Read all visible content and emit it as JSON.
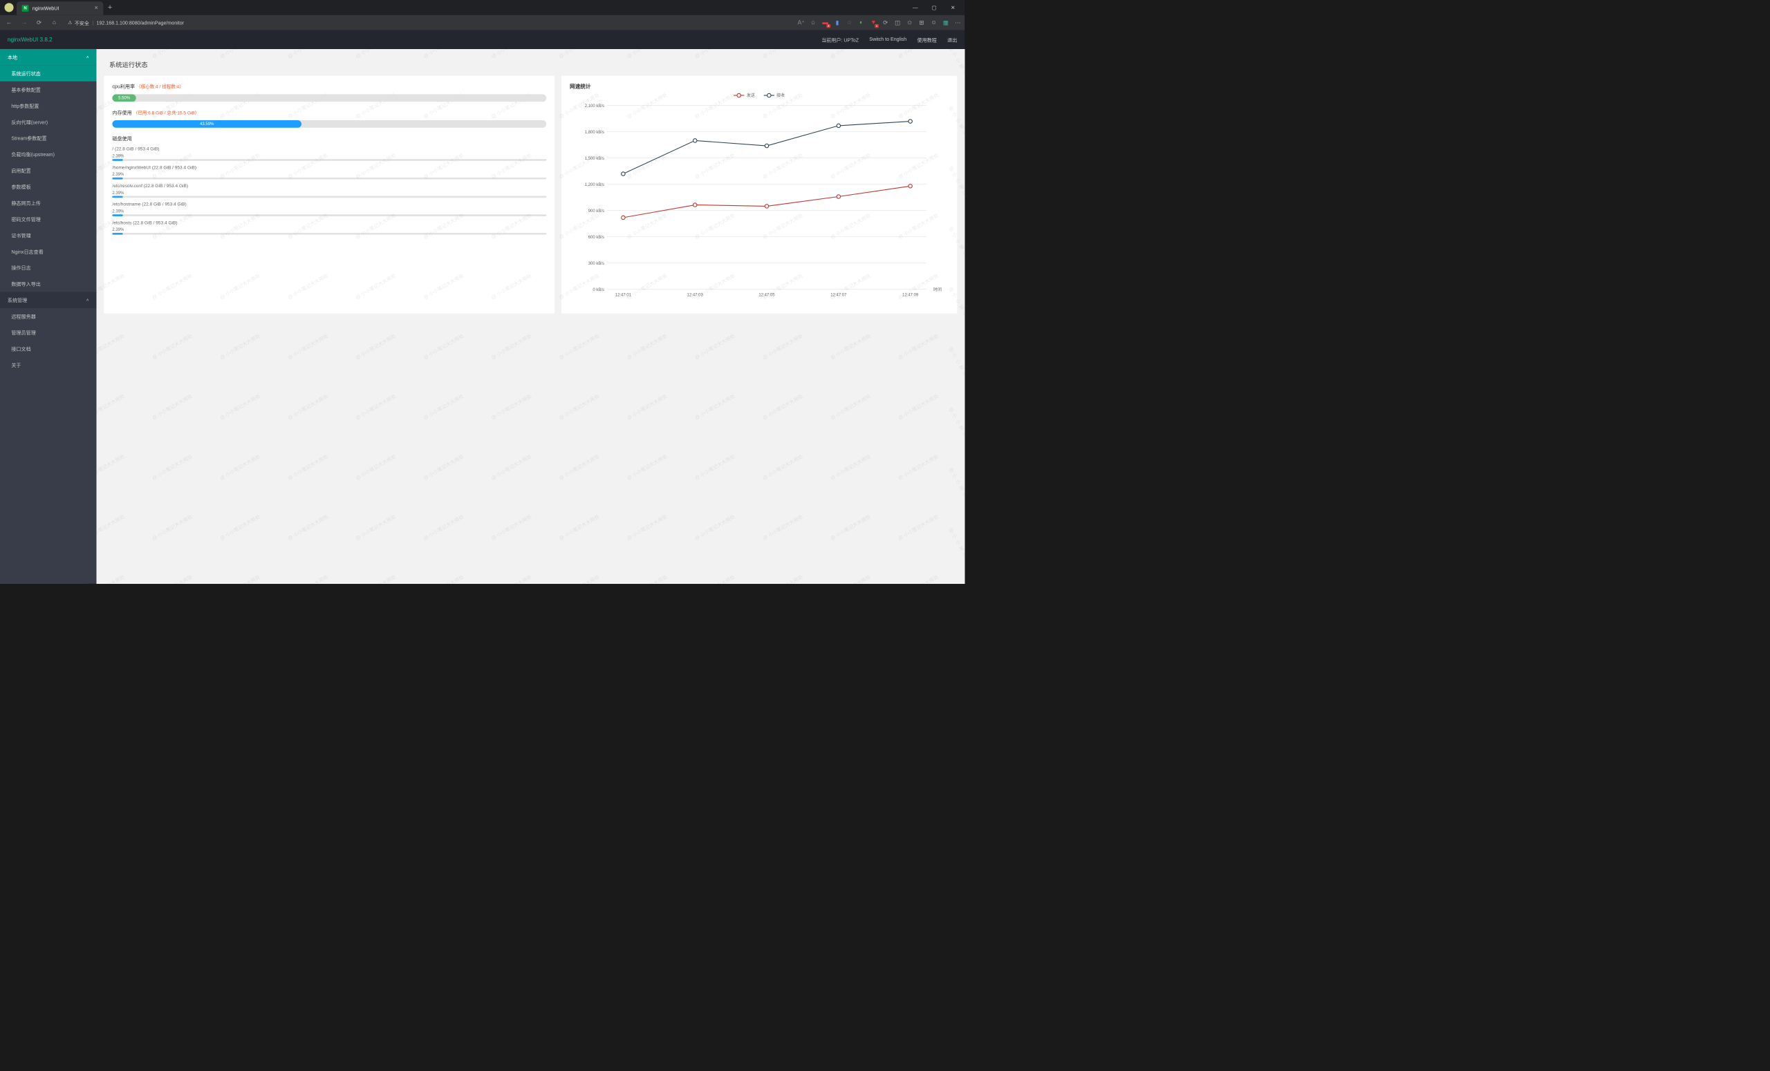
{
  "browser": {
    "tab_title": "nginxWebUI",
    "url_warning": "不安全",
    "url": "192.168.1.100:8080/adminPage/monitor"
  },
  "app": {
    "title": "nginxWebUI 3.8.2",
    "user_label": "当前用户: UPToZ",
    "switch_lang": "Switch to English",
    "tutorial": "使用教程",
    "logout": "退出"
  },
  "sidebar": {
    "group_local": "本地",
    "items_local": [
      "系统运行状态",
      "基本参数配置",
      "http参数配置",
      "反向代理(server)",
      "Stream参数配置",
      "负载均衡(upstream)",
      "启用配置",
      "参数模板",
      "静态网页上传",
      "密码文件管理",
      "证书管理",
      "Nginx日志查看",
      "操作日志",
      "数据导入导出"
    ],
    "group_sys": "系统管理",
    "items_sys": [
      "远程服务器",
      "管理员管理",
      "接口文档",
      "关于"
    ]
  },
  "page": {
    "title": "系统运行状态",
    "cpu_label": "cpu利用率",
    "cpu_sub": "（核心数:4 / 线程数:4）",
    "cpu_pct": "5.50%",
    "mem_label": "内存使用",
    "mem_sub": "（已用:6.8 GiB / 总共:15.5 GiB）",
    "mem_pct": "43.59%",
    "disk_label": "磁盘使用",
    "disks": [
      {
        "path": "/ (22.8 GiB / 953.4 GiB)",
        "pct": "2.39%"
      },
      {
        "path": "/home/nginxWebUI (22.8 GiB / 953.4 GiB)",
        "pct": "2.39%"
      },
      {
        "path": "/etc/resolv.conf (22.8 GiB / 953.4 GiB)",
        "pct": "2.39%"
      },
      {
        "path": "/etc/hostname (22.8 GiB / 953.4 GiB)",
        "pct": "2.39%"
      },
      {
        "path": "/etc/hosts (22.8 GiB / 953.4 GiB)",
        "pct": "2.39%"
      }
    ]
  },
  "chart_data": {
    "type": "line",
    "title": "网速统计",
    "xlabel": "时间",
    "ylabel": "",
    "categories": [
      "12:47:01",
      "12:47:03",
      "12:47:05",
      "12:47:07",
      "12:47:09"
    ],
    "y_ticks": [
      "0 kB/s",
      "300 kB/s",
      "600 kB/s",
      "900 kB/s",
      "1,200 kB/s",
      "1,500 kB/s",
      "1,800 kB/s",
      "2,100 kB/s"
    ],
    "ylim": [
      0,
      2100
    ],
    "series": [
      {
        "name": "发送",
        "color": "#c23531",
        "values": [
          820,
          965,
          950,
          1060,
          1180
        ]
      },
      {
        "name": "接收",
        "color": "#2f4554",
        "values": [
          1320,
          1700,
          1640,
          1870,
          1920
        ]
      }
    ]
  },
  "watermark_text": "@ 小小笔记大大用处"
}
